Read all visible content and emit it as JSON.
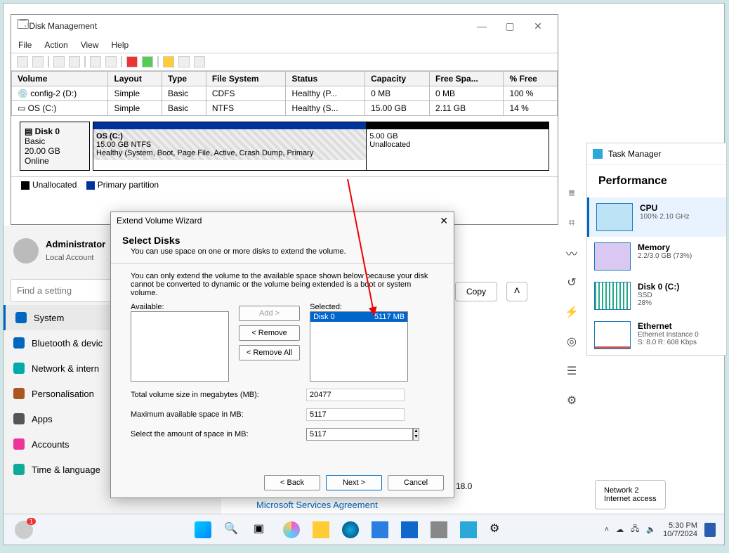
{
  "diskMgmt": {
    "title": "Disk Management",
    "menu": [
      "File",
      "Action",
      "View",
      "Help"
    ],
    "columns": [
      "Volume",
      "Layout",
      "Type",
      "File System",
      "Status",
      "Capacity",
      "Free Spa...",
      "% Free"
    ],
    "rows": [
      {
        "vol": "config-2 (D:)",
        "layout": "Simple",
        "type": "Basic",
        "fs": "CDFS",
        "status": "Healthy (P...",
        "cap": "0 MB",
        "free": "0 MB",
        "pct": "100 %"
      },
      {
        "vol": "OS (C:)",
        "layout": "Simple",
        "type": "Basic",
        "fs": "NTFS",
        "status": "Healthy (S...",
        "cap": "15.00 GB",
        "free": "2.11 GB",
        "pct": "14 %"
      }
    ],
    "disk": {
      "name": "Disk 0",
      "mode": "Basic",
      "size": "20.00 GB",
      "state": "Online"
    },
    "partOS": {
      "name": "OS  (C:)",
      "line2": "15.00 GB NTFS",
      "line3": "Healthy (System, Boot, Page File, Active, Crash Dump, Primary"
    },
    "partUn": {
      "line1": "5.00 GB",
      "line2": "Unallocated"
    },
    "legendUn": "Unallocated",
    "legendPr": "Primary partition"
  },
  "settings": {
    "user": "Administrator",
    "type": "Local Account",
    "searchPH": "Find a setting",
    "items": [
      "System",
      "Bluetooth & devic",
      "Network & intern",
      "Personalisation",
      "Apps",
      "Accounts",
      "Time & language"
    ],
    "colors": [
      "#0067c0",
      "#0067c0",
      "#0aa",
      "#a52",
      "#555",
      "#e39",
      "#1a9"
    ]
  },
  "wizard": {
    "title": "Extend Volume Wizard",
    "h": "Select Disks",
    "sub": "You can use space on one or more disks to extend the volume.",
    "note": "You can only extend the volume to the available space shown below because your disk cannot be converted to dynamic or the volume being extended is a boot or system volume.",
    "avLabel": "Available:",
    "selLabel": "Selected:",
    "selDisk": "Disk 0",
    "selMB": "5117 MB",
    "btnAdd": "Add >",
    "btnRemove": "< Remove",
    "btnRemAll": "< Remove All",
    "f1": "Total volume size in megabytes (MB):",
    "v1": "20477",
    "f2": "Maximum available space in MB:",
    "v2": "5117",
    "f3": "Select the amount of space in MB:",
    "v3": "5117",
    "back": "< Back",
    "next": "Next >",
    "cancel": "Cancel"
  },
  "misc": {
    "copy": "Copy",
    "ms": "Microsoft Services Agreement",
    "clip": "18.0"
  },
  "tm": {
    "label": "Task Manager",
    "section": "Performance",
    "items": [
      {
        "t": "CPU",
        "s": "100%  2.10 GHz"
      },
      {
        "t": "Memory",
        "s": "2.2/3.0 GB (73%)"
      },
      {
        "t": "Disk 0 (C:)",
        "s": "SSD",
        "s2": "28%"
      },
      {
        "t": "Ethernet",
        "s": "Ethernet Instance 0",
        "s2": "S: 8.0  R: 608 Kbps"
      }
    ]
  },
  "net": {
    "l1": "Network 2",
    "l2": "Internet access"
  },
  "tray": {
    "time": "5:30 PM",
    "date": "10/7/2024",
    "badge": "1"
  }
}
